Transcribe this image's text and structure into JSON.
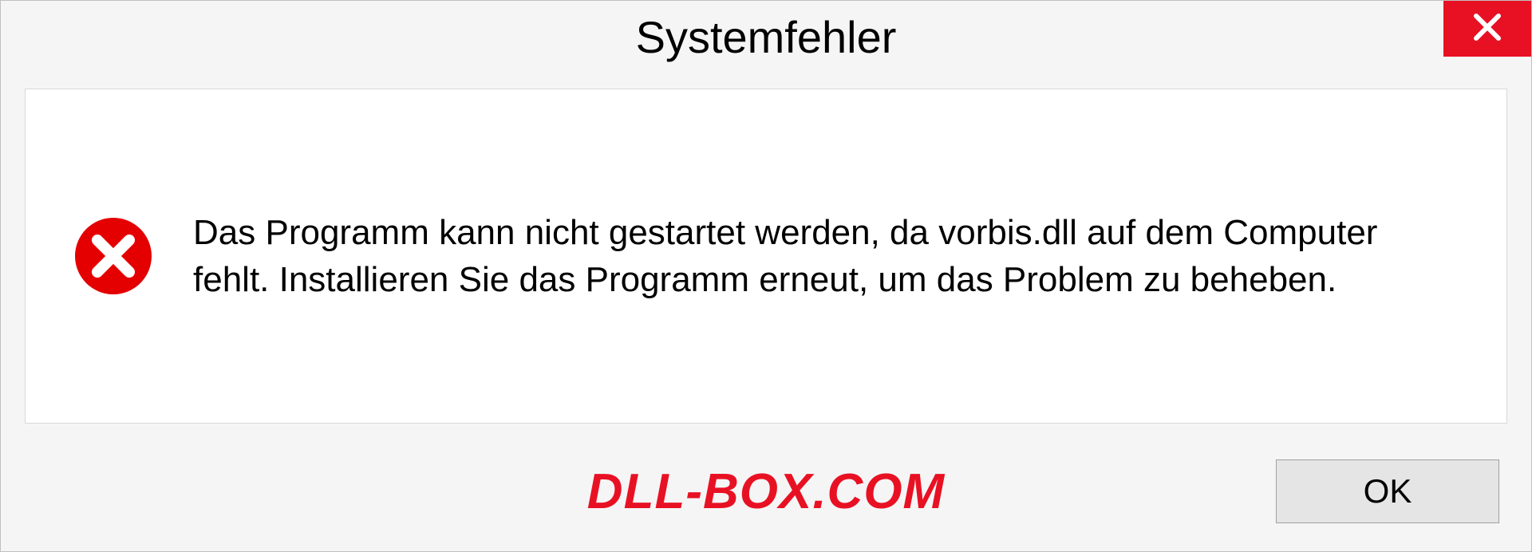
{
  "dialog": {
    "title": "Systemfehler",
    "message": "Das Programm kann nicht gestartet werden, da vorbis.dll auf dem Computer fehlt. Installieren Sie das Programm erneut, um das Problem zu beheben.",
    "ok_label": "OK"
  },
  "watermark": "DLL-BOX.COM"
}
